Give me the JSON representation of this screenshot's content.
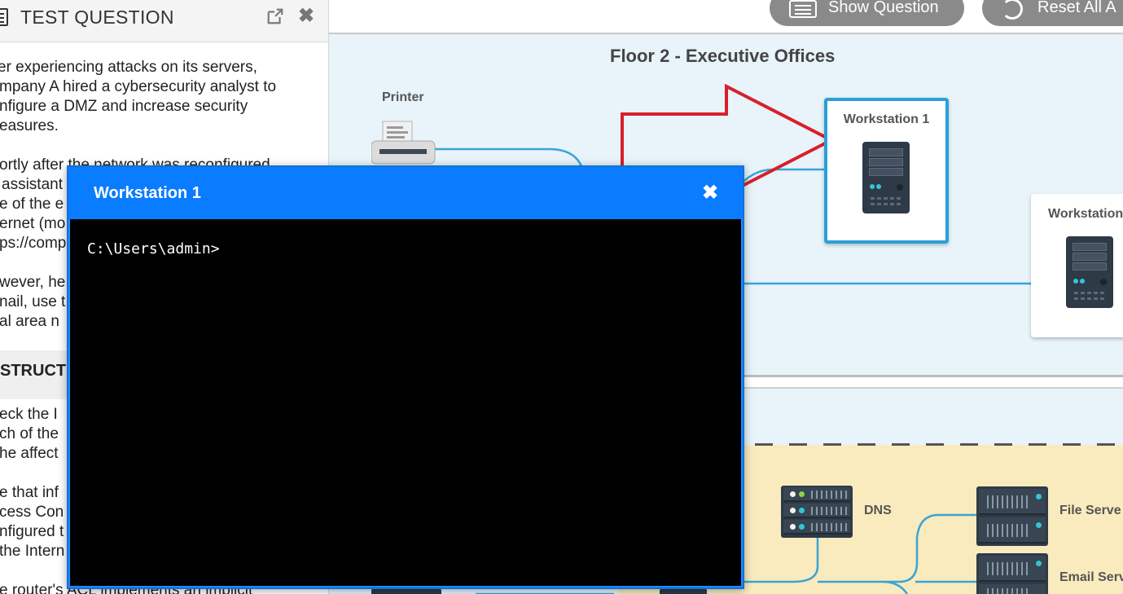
{
  "question_panel": {
    "title": "TEST QUESTION",
    "lines": [
      "er experiencing attacks on its servers,",
      "mpany A hired a cybersecurity analyst to",
      "nfigure a DMZ and increase security",
      "easures.",
      "ortly after the network was reconfigured",
      "assistant",
      "e of the e",
      "ernet (mo",
      "ps://comp",
      "wever, he",
      "nail, use t",
      "al area n",
      "eck the I",
      "ch of the",
      "he affect",
      "e that inf",
      "cess Con",
      "nfigured t",
      "the Intern",
      "e router's ACL implements an implicit"
    ],
    "section_heading": "STRUCT"
  },
  "toolbar": {
    "show_question_label": "Show Question",
    "reset_label": "Reset All A"
  },
  "diagram": {
    "floor_title": "Floor 2 - Executive Offices",
    "printer_label": "Printer",
    "workstation1_label": "Workstation 1",
    "workstation2_label": "Workstation",
    "dns_label": "DNS",
    "file_server_label": "File Serve",
    "email_server_label": "Email Serv",
    "accent_color": "#2aa0d6",
    "arrow_color": "#d8202a"
  },
  "modal": {
    "title": "Workstation 1",
    "close_icon": "close-icon",
    "prompt": "C:\\Users\\admin>"
  }
}
